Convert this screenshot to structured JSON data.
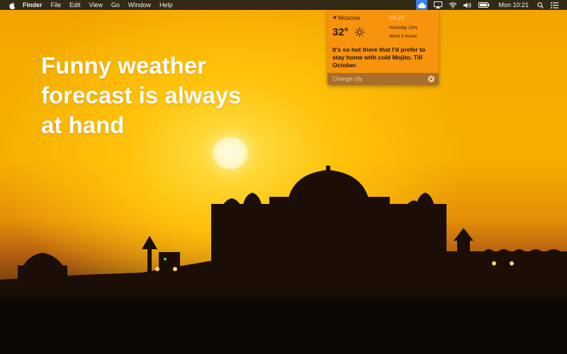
{
  "menubar": {
    "app_name": "Finder",
    "items": [
      "File",
      "Edit",
      "View",
      "Go",
      "Window",
      "Help"
    ],
    "clock": "Mon 10:21"
  },
  "headline": {
    "line1": "Funny weather",
    "line2": "forecast is always",
    "line3": "at hand"
  },
  "weather": {
    "city": "Moscow",
    "time": "09:21",
    "temperature": "32°",
    "humidity": "Humidity 23%",
    "wind": "Wind 2 m/sec",
    "message": "It's so hot there that I'd prefer to stay home with cold Mojito. Till October.",
    "change_city": "Change city",
    "condition_icon": "sun-icon"
  },
  "colors": {
    "popover_bg": "#f7930c",
    "popover_footer": "#a86e2a",
    "tray_highlight": "#3b82e8"
  }
}
